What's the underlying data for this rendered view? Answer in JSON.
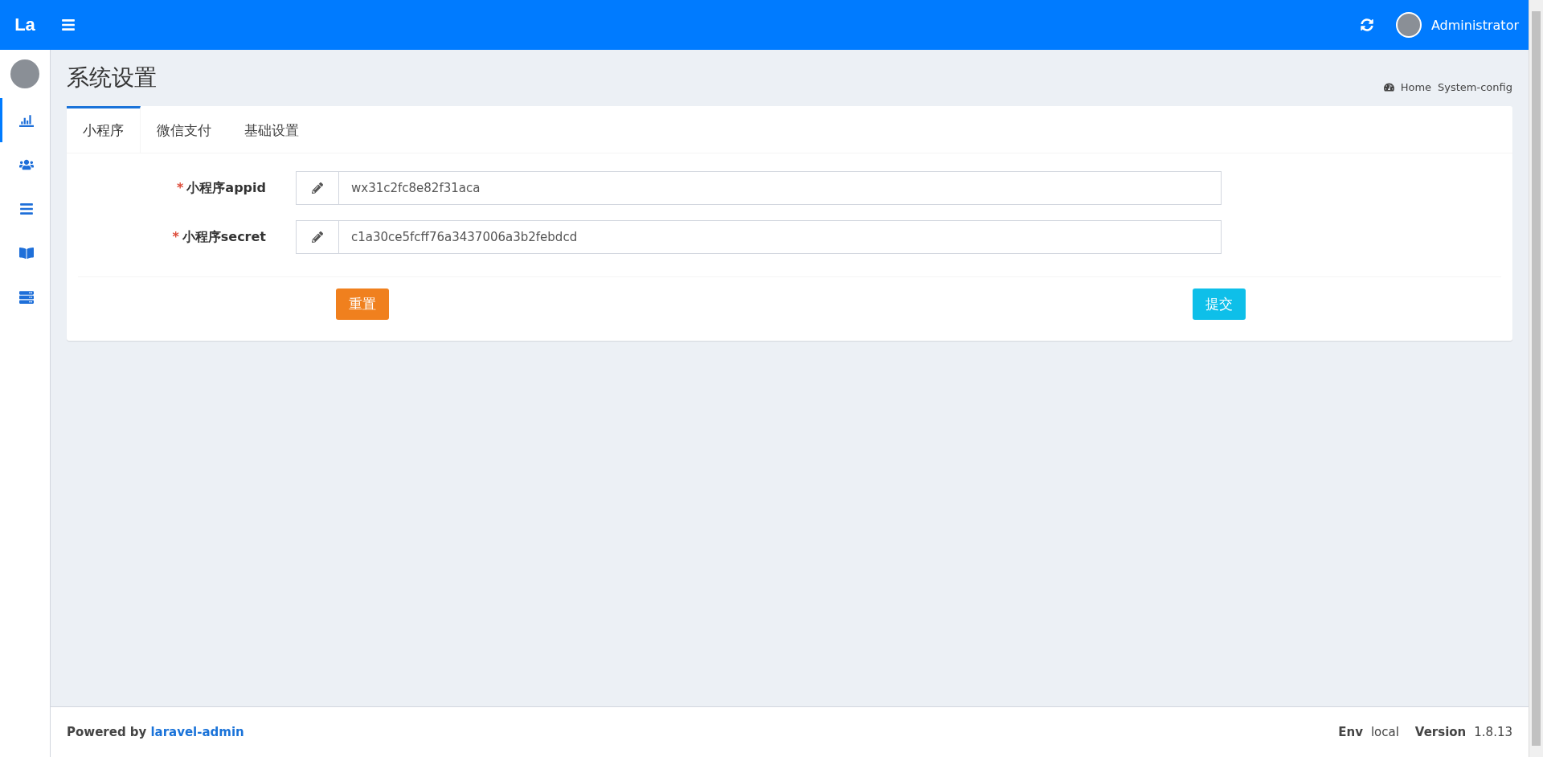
{
  "header": {
    "logo": "La",
    "user": "Administrator"
  },
  "sidebar": {
    "items": [
      {
        "kind": "chart",
        "selected": true
      },
      {
        "kind": "users",
        "selected": false
      },
      {
        "kind": "list",
        "selected": false
      },
      {
        "kind": "book",
        "selected": false
      },
      {
        "kind": "server",
        "selected": false
      }
    ]
  },
  "page": {
    "title": "系统设置",
    "breadcrumb": [
      "Home",
      "System-config"
    ]
  },
  "tabs": [
    {
      "label": "小程序",
      "selected": true
    },
    {
      "label": "微信支付",
      "selected": false
    },
    {
      "label": "基础设置",
      "selected": false
    }
  ],
  "fields": [
    {
      "label": "小程序appid",
      "required_mark": "*",
      "value": "wx31c2fc8e82f31aca"
    },
    {
      "label": "小程序secret",
      "required_mark": "*",
      "value": "c1a30ce5fcff76a3437006a3b2febdcd"
    }
  ],
  "buttons": {
    "reset": "重置",
    "submit": "提交"
  },
  "footer": {
    "powered": "Powered by",
    "link": "laravel-admin",
    "env_label": "Env",
    "env": "local",
    "version_label": "Version",
    "version": "1.8.13"
  }
}
